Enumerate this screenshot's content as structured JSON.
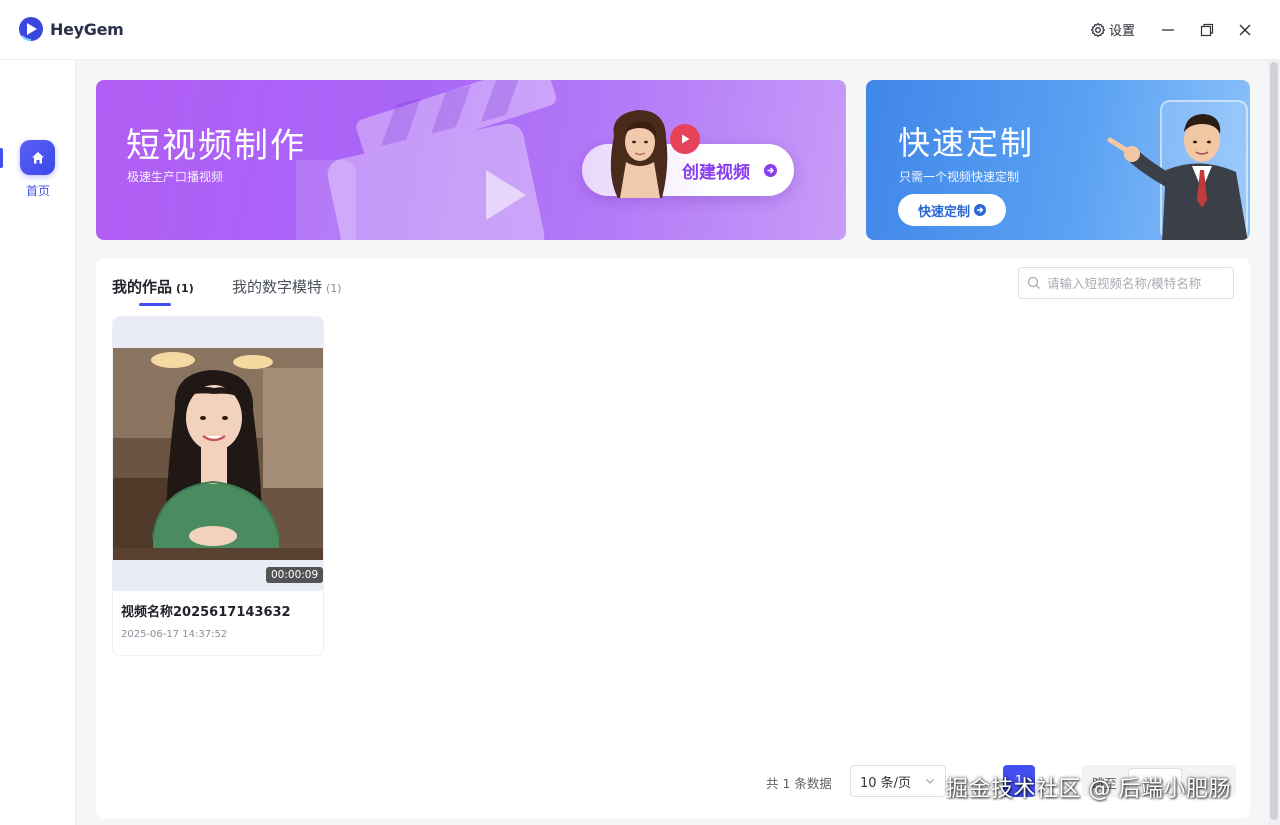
{
  "app": {
    "name": "HeyGem"
  },
  "titlebar": {
    "settings_label": "设置"
  },
  "sidebar": {
    "items": [
      {
        "label": "首页"
      }
    ]
  },
  "banners": {
    "short_video": {
      "title": "短视频制作",
      "subtitle": "极速生产口播视频",
      "cta": "创建视频"
    },
    "custom": {
      "title": "快速定制",
      "subtitle": "只需一个视频快速定制",
      "cta": "快速定制"
    }
  },
  "tabs": [
    {
      "label": "我的作品",
      "count": "(1)"
    },
    {
      "label": "我的数字模特",
      "count": "(1)"
    }
  ],
  "search": {
    "placeholder": "请输入短视频名称/模特名称"
  },
  "videos": [
    {
      "title": "视频名称2025617143632",
      "date": "2025-06-17 14:37:52",
      "duration": "00:00:09"
    }
  ],
  "pagination": {
    "total_text": "共 1 条数据",
    "page_size": "10 条/页",
    "current_page": "1",
    "jump_label": "跳至"
  },
  "watermark": "掘金技术社区 @ 后端小肥肠",
  "colors": {
    "accent": "#4250f0",
    "banner_purple": "#b25df5",
    "banner_blue": "#3f86ea"
  }
}
